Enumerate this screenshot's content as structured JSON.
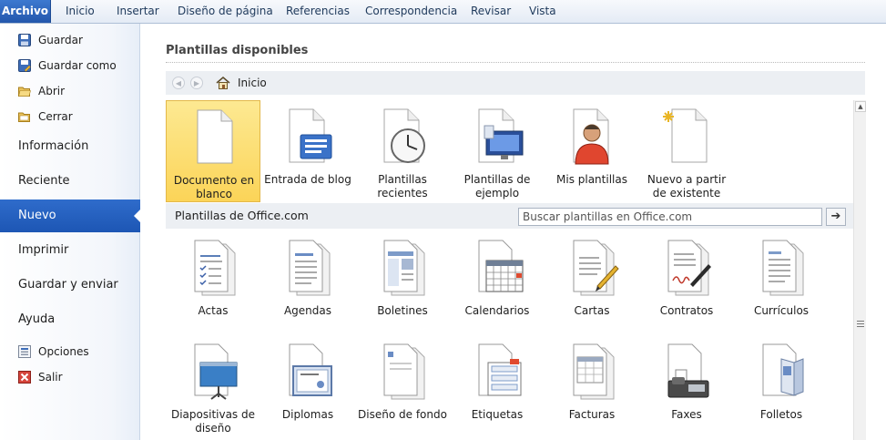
{
  "ribbon": {
    "file_tab": "Archivo",
    "tabs": [
      "Inicio",
      "Insertar",
      "Diseño de página",
      "Referencias",
      "Correspondencia",
      "Revisar",
      "Vista"
    ]
  },
  "nav": {
    "top_actions": [
      {
        "label": "Guardar",
        "icon": "save-icon"
      },
      {
        "label": "Guardar como",
        "icon": "save-as-icon"
      },
      {
        "label": "Abrir",
        "icon": "open-folder-icon"
      },
      {
        "label": "Cerrar",
        "icon": "close-folder-icon"
      }
    ],
    "sections": [
      "Información",
      "Reciente",
      "Nuevo",
      "Imprimir",
      "Guardar y enviar",
      "Ayuda"
    ],
    "selected_section": "Nuevo",
    "bottom_actions": [
      {
        "label": "Opciones",
        "icon": "options-icon"
      },
      {
        "label": "Salir",
        "icon": "exit-icon"
      }
    ]
  },
  "main": {
    "title": "Plantillas disponibles",
    "breadcrumb": "Inicio",
    "top_templates": [
      {
        "label": "Documento en blanco",
        "icon": "blank-document-icon",
        "selected": true
      },
      {
        "label": "Entrada de blog",
        "icon": "blog-post-icon"
      },
      {
        "label": "Plantillas recientes",
        "icon": "recent-templates-icon"
      },
      {
        "label": "Plantillas de ejemplo",
        "icon": "sample-templates-icon"
      },
      {
        "label": "Mis plantillas",
        "icon": "my-templates-icon"
      },
      {
        "label": "Nuevo a partir de existente",
        "icon": "new-from-existing-icon"
      }
    ],
    "office_section": {
      "title": "Plantillas de Office.com",
      "search_placeholder": "Buscar plantillas en Office.com"
    },
    "office_templates": [
      {
        "label": "Actas",
        "icon": "minutes-icon"
      },
      {
        "label": "Agendas",
        "icon": "agendas-icon"
      },
      {
        "label": "Boletines",
        "icon": "newsletters-icon"
      },
      {
        "label": "Calendarios",
        "icon": "calendar-icon"
      },
      {
        "label": "Cartas",
        "icon": "letters-icon"
      },
      {
        "label": "Contratos",
        "icon": "contracts-icon"
      },
      {
        "label": "Currículos",
        "icon": "resumes-icon"
      },
      {
        "label": "Diapositivas de diseño",
        "icon": "presentation-icon"
      },
      {
        "label": "Diplomas",
        "icon": "diploma-icon"
      },
      {
        "label": "Diseño de fondo",
        "icon": "background-design-icon"
      },
      {
        "label": "Etiquetas",
        "icon": "labels-icon"
      },
      {
        "label": "Facturas",
        "icon": "invoices-icon"
      },
      {
        "label": "Faxes",
        "icon": "fax-icon"
      },
      {
        "label": "Folletos",
        "icon": "brochures-icon"
      }
    ]
  },
  "colors": {
    "file_tab": "#2a62bb",
    "nav_selected": "#2563c4",
    "tile_selected": "#fbd458"
  }
}
